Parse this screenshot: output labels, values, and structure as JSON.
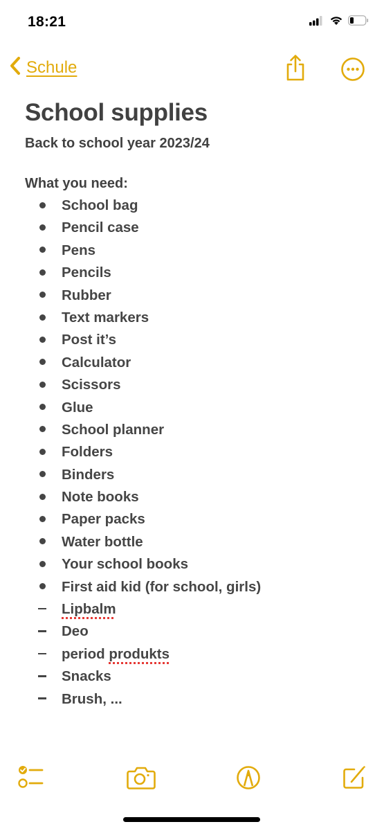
{
  "status_bar": {
    "time": "18:21",
    "signal_icon": "cellular-signal-icon",
    "wifi_icon": "wifi-icon",
    "battery_icon": "battery-low-icon"
  },
  "nav": {
    "back_label": "Schule",
    "back_icon": "chevron-left-icon",
    "share_icon": "share-icon",
    "more_icon": "ellipsis-circle-icon"
  },
  "note": {
    "title": "School supplies",
    "subtitle": "Back to school year 2023/24",
    "section_heading": "What you need:",
    "items": [
      {
        "text": "School bag",
        "marker": "bullet"
      },
      {
        "text": "Pencil case",
        "marker": "bullet"
      },
      {
        "text": "Pens",
        "marker": "bullet"
      },
      {
        "text": "Pencils",
        "marker": "bullet"
      },
      {
        "text": "Rubber",
        "marker": "bullet"
      },
      {
        "text": "Text markers",
        "marker": "bullet"
      },
      {
        "text": "Post it’s",
        "marker": "bullet"
      },
      {
        "text": "Calculator",
        "marker": "bullet"
      },
      {
        "text": "Scissors",
        "marker": "bullet"
      },
      {
        "text": "Glue",
        "marker": "bullet"
      },
      {
        "text": "School planner",
        "marker": "bullet"
      },
      {
        "text": "Folders",
        "marker": "bullet"
      },
      {
        "text": "Binders",
        "marker": "bullet"
      },
      {
        "text": "Note books",
        "marker": "bullet"
      },
      {
        "text": "Paper packs",
        "marker": "bullet"
      },
      {
        "text": "Water bottle",
        "marker": "bullet"
      },
      {
        "text": "Your school books",
        "marker": "bullet"
      },
      {
        "text": "First aid kid (for school, girls)",
        "marker": "bullet"
      },
      {
        "text": "Lipbalm",
        "marker": "dash",
        "misspelled": [
          "Lipbalm"
        ]
      },
      {
        "text": "Deo",
        "marker": "dash"
      },
      {
        "text": "period produkts",
        "marker": "dash",
        "misspelled": [
          "produkts"
        ]
      },
      {
        "text": "Snacks",
        "marker": "dash"
      },
      {
        "text": "Brush, ...",
        "marker": "dash"
      }
    ]
  },
  "toolbar": {
    "checklist_icon": "checklist-icon",
    "camera_icon": "camera-icon",
    "markup_icon": "markup-pen-icon",
    "compose_icon": "compose-icon"
  },
  "colors": {
    "accent": "#E2AB0C",
    "text": "#454545",
    "spellcheck": "#E53935",
    "background": "#FFFFFF"
  }
}
